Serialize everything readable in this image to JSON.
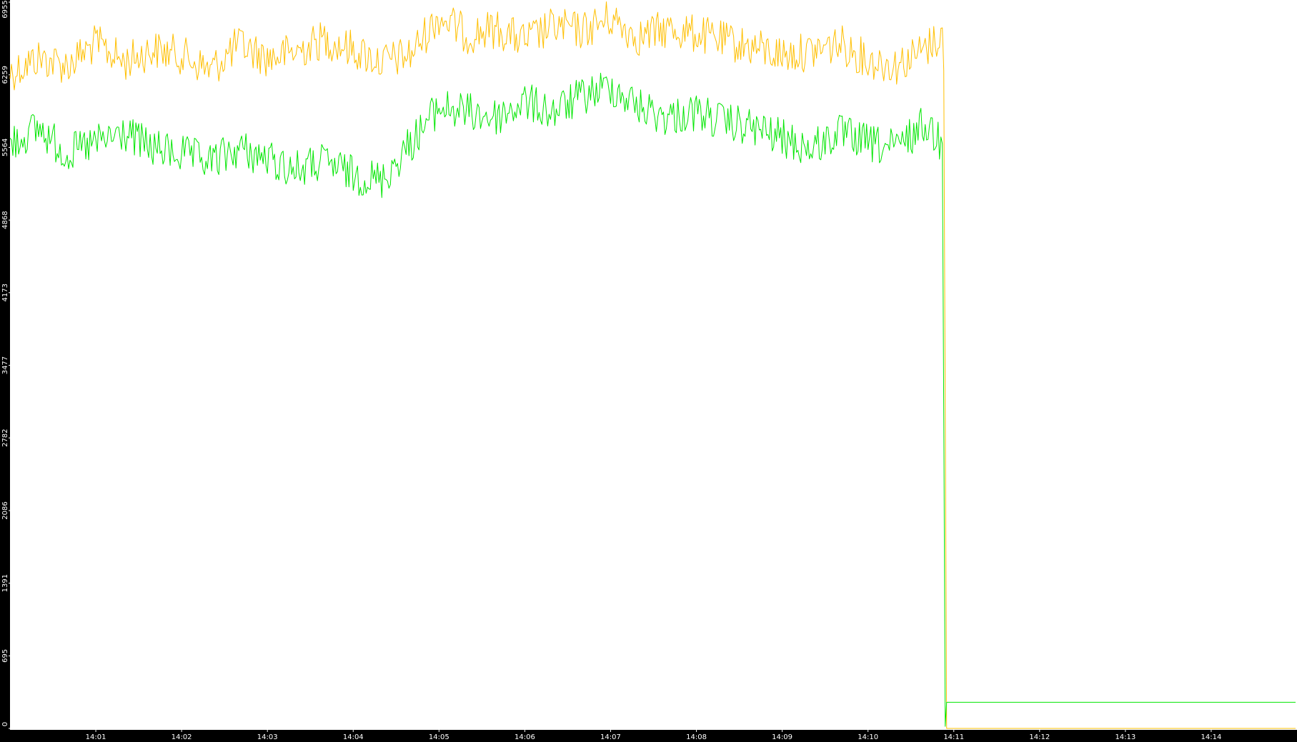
{
  "chart_data": {
    "type": "line",
    "title": "",
    "xlabel": "",
    "ylabel": "",
    "background_color": "#ffffff",
    "axis_band_color": "#000000",
    "tick_label_color": "#ffffff",
    "grid": false,
    "legend": "none",
    "xlim": [
      "14:00:00",
      "14:15:00"
    ],
    "ylim": [
      0,
      6955
    ],
    "x_tick_labels": [
      "14:01",
      "14:02",
      "14:03",
      "14:04",
      "14:05",
      "14:06",
      "14:07",
      "14:08",
      "14:09",
      "14:10",
      "14:11",
      "14:12",
      "14:13",
      "14:14"
    ],
    "y_tick_labels": [
      "0",
      "695",
      "1391",
      "2086",
      "2782",
      "3477",
      "4173",
      "4868",
      "5564",
      "6259",
      "6955"
    ],
    "series": [
      {
        "color": "#ffbf00",
        "x": [
          "14:00:00",
          "14:00:20",
          "14:00:40",
          "14:01:00",
          "14:01:20",
          "14:01:40",
          "14:02:00",
          "14:02:20",
          "14:02:40",
          "14:03:00",
          "14:03:20",
          "14:03:40",
          "14:04:00",
          "14:04:20",
          "14:04:40",
          "14:05:00",
          "14:05:20",
          "14:05:40",
          "14:06:00",
          "14:06:20",
          "14:06:40",
          "14:07:00",
          "14:07:20",
          "14:07:40",
          "14:08:00",
          "14:08:20",
          "14:08:40",
          "14:09:00",
          "14:09:20",
          "14:09:40",
          "14:10:00",
          "14:10:20",
          "14:10:40",
          "14:10:52",
          "14:10:53",
          "14:10:55",
          "14:11:30",
          "14:12:00",
          "14:13:00",
          "14:14:00",
          "14:14:59"
        ],
        "y": [
          6280,
          6420,
          6350,
          6560,
          6380,
          6500,
          6450,
          6300,
          6550,
          6420,
          6480,
          6600,
          6500,
          6380,
          6450,
          6820,
          6640,
          6700,
          6580,
          6720,
          6680,
          6800,
          6620,
          6700,
          6650,
          6580,
          6520,
          6450,
          6480,
          6560,
          6400,
          6350,
          6500,
          6650,
          6300,
          0,
          0,
          0,
          0,
          0,
          0
        ]
      },
      {
        "color": "#00e600",
        "x": [
          "14:00:00",
          "14:00:20",
          "14:00:40",
          "14:01:00",
          "14:01:20",
          "14:01:40",
          "14:02:00",
          "14:02:20",
          "14:02:40",
          "14:03:00",
          "14:03:20",
          "14:03:40",
          "14:04:00",
          "14:04:20",
          "14:04:40",
          "14:05:00",
          "14:05:20",
          "14:05:40",
          "14:06:00",
          "14:06:20",
          "14:06:40",
          "14:07:00",
          "14:07:20",
          "14:07:40",
          "14:08:00",
          "14:08:20",
          "14:08:40",
          "14:09:00",
          "14:09:20",
          "14:09:40",
          "14:10:00",
          "14:10:20",
          "14:10:40",
          "14:10:52",
          "14:10:53",
          "14:10:54",
          "14:10:55",
          "14:11:00",
          "14:12:00",
          "14:13:00",
          "14:14:00",
          "14:14:59"
        ],
        "y": [
          5600,
          5750,
          5500,
          5600,
          5700,
          5550,
          5500,
          5420,
          5550,
          5450,
          5350,
          5420,
          5300,
          5250,
          5600,
          5950,
          5900,
          5850,
          6000,
          5900,
          6050,
          6150,
          5950,
          5850,
          5900,
          5800,
          5750,
          5650,
          5550,
          5700,
          5600,
          5550,
          5800,
          5600,
          3000,
          20,
          250,
          250,
          250,
          250,
          250,
          250
        ]
      }
    ]
  }
}
